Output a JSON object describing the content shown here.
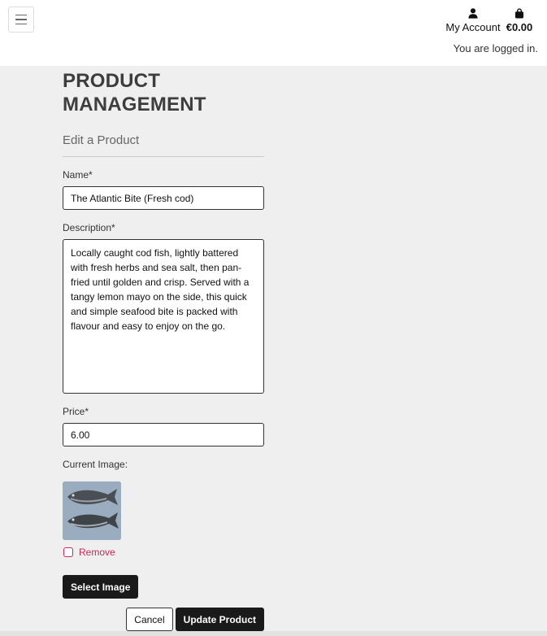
{
  "header": {
    "account_label": "My Account",
    "bag_total": "€0.00",
    "login_status": "You are logged in."
  },
  "page": {
    "title": "PRODUCT MANAGEMENT",
    "subtitle": "Edit a Product"
  },
  "form": {
    "name_label": "Name*",
    "name_value": "The Atlantic Bite (Fresh cod)",
    "description_label": "Description*",
    "description_value": "Locally caught cod fish, lightly battered with fresh herbs and sea salt, then pan-fried until golden and crisp. Served with a tangy lemon mayo on the side, this quick and simple seafood bite is packed with flavour and easy to enjoy on the go.",
    "price_label": "Price*",
    "price_value": "6.00",
    "current_image_label": "Current Image:",
    "remove_label": "Remove",
    "select_image_label": "Select Image",
    "cancel_label": "Cancel",
    "submit_label": "Update Product"
  },
  "icons": {
    "menu": "hamburger-icon",
    "account": "user-icon",
    "bag": "shopping-bag-icon"
  },
  "colors": {
    "accent_danger": "#c62a5a",
    "button_dark": "#1a1a1a",
    "page_bg": "#efefef"
  }
}
